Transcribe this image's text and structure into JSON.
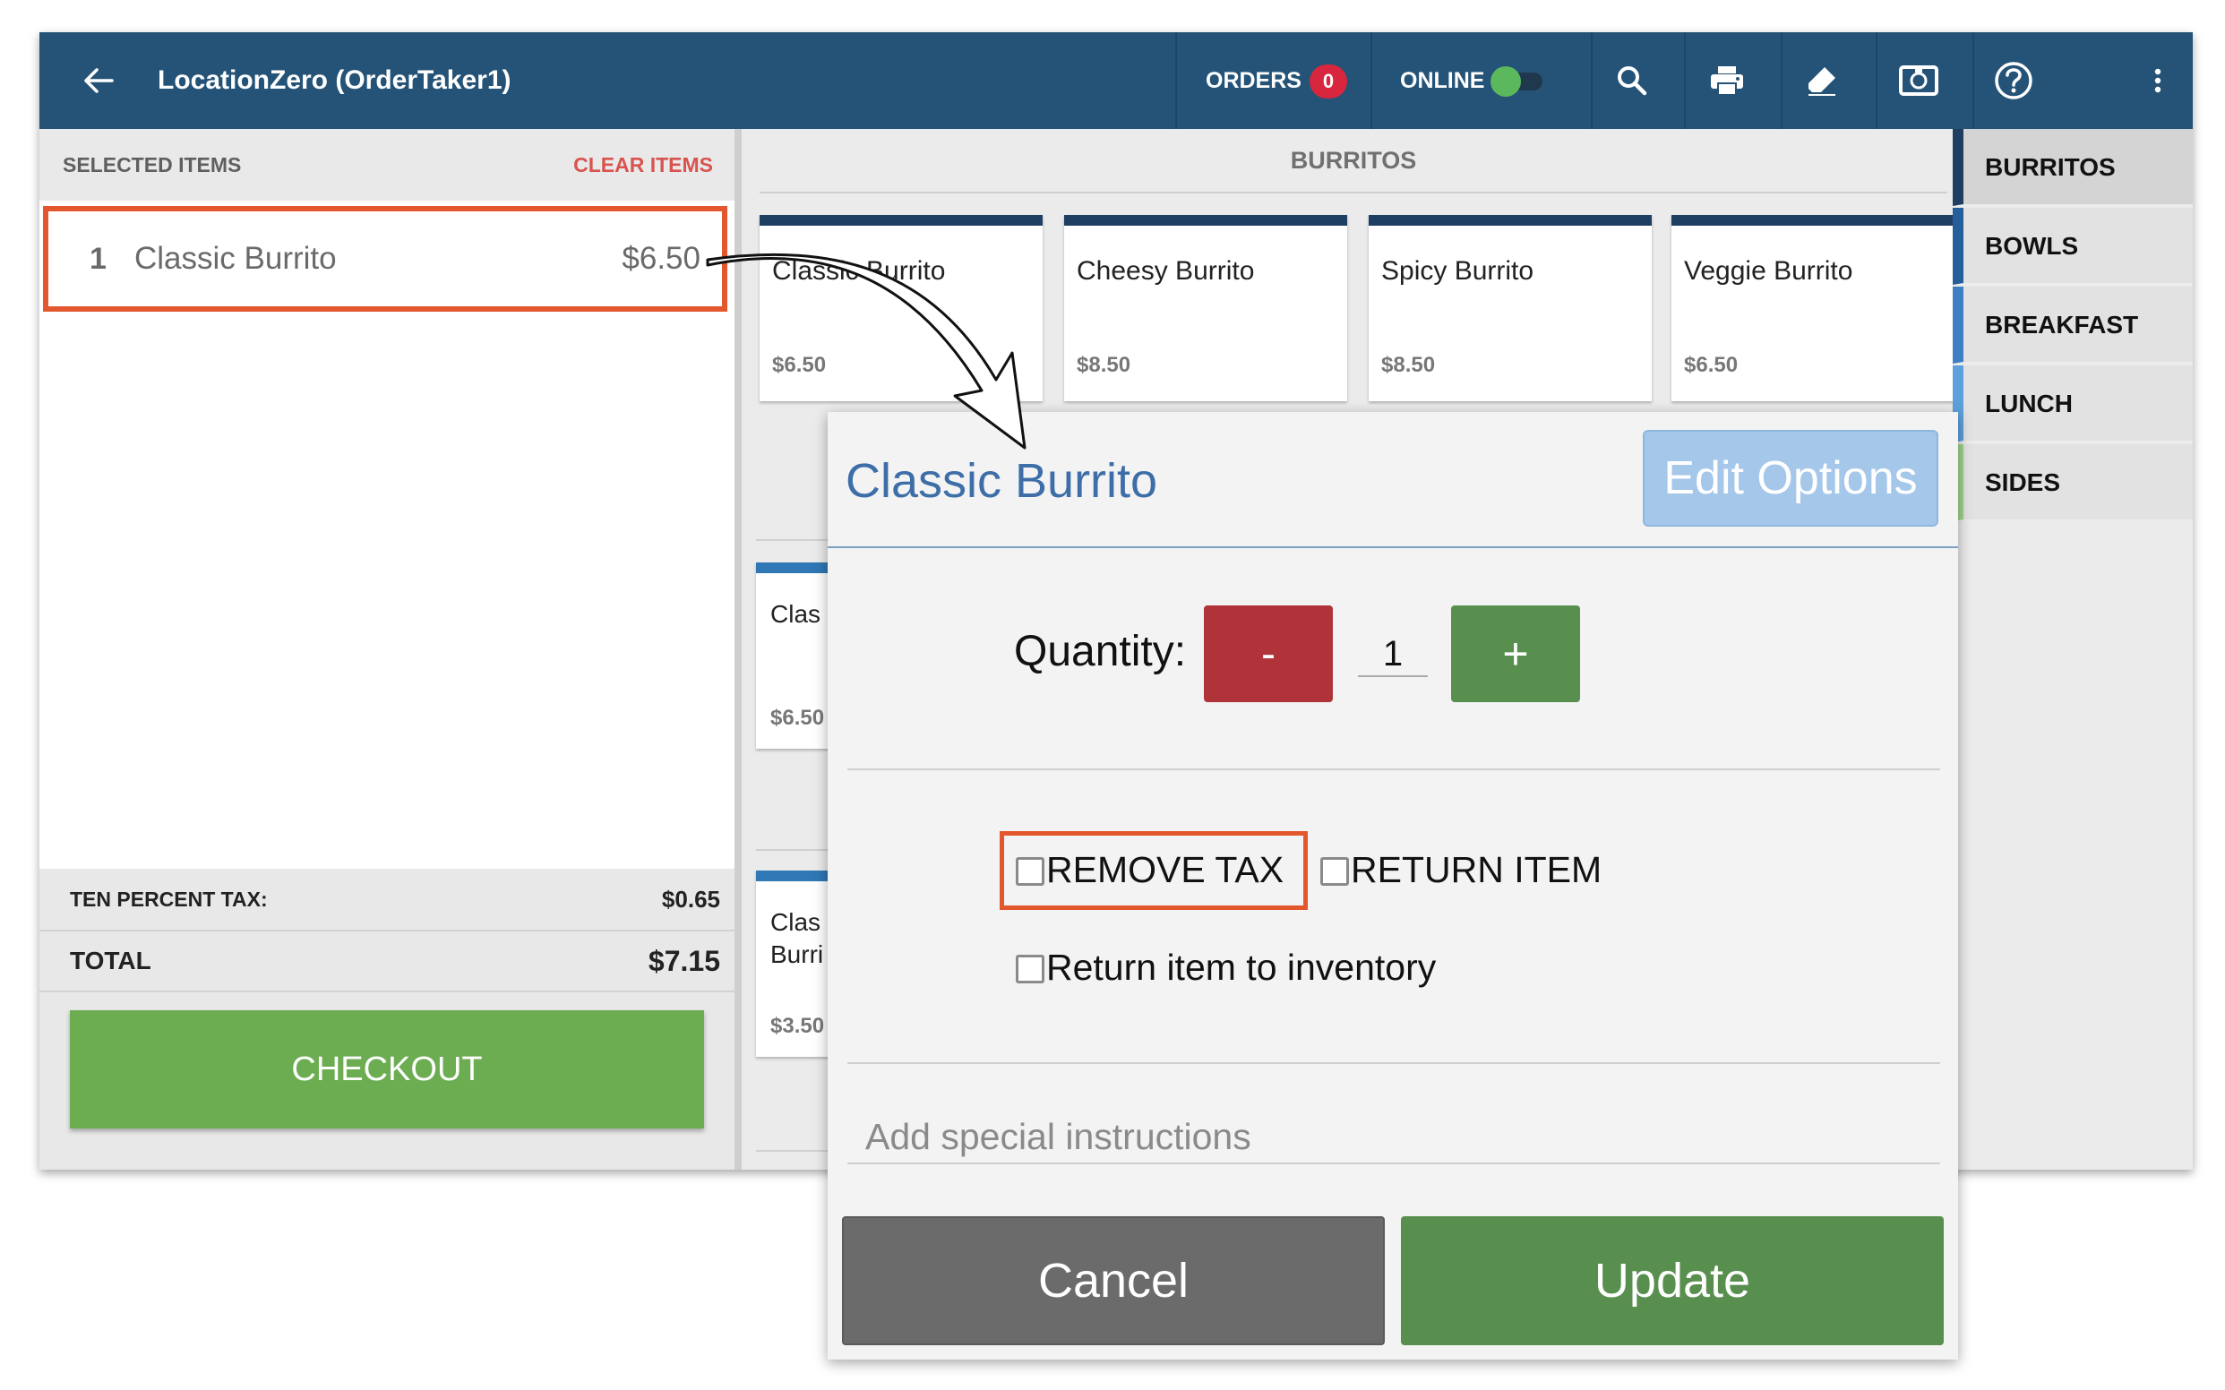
{
  "topbar": {
    "title": "LocationZero (OrderTaker1)",
    "orders_label": "ORDERS",
    "orders_count": "0",
    "online_label": "ONLINE",
    "online": true,
    "icons": [
      "back-arrow-icon",
      "search-icon",
      "printer-icon",
      "eraser-icon",
      "cash-drawer-icon",
      "help-icon",
      "more-vert-icon"
    ]
  },
  "order": {
    "header": "SELECTED ITEMS",
    "clear_label": "CLEAR ITEMS",
    "items": [
      {
        "qty": "1",
        "name": "Classic Burrito",
        "price": "$6.50"
      }
    ],
    "tax_label": "TEN PERCENT TAX:",
    "tax_value": "$0.65",
    "total_label": "TOTAL",
    "total_value": "$7.15",
    "checkout_label": "CHECKOUT"
  },
  "menu": {
    "category_title": "BURRITOS",
    "cards": [
      {
        "name": "Classic Burrito",
        "price": "$6.50"
      },
      {
        "name": "Cheesy Burrito",
        "price": "$8.50"
      },
      {
        "name": "Spicy Burrito",
        "price": "$8.50"
      },
      {
        "name": "Veggie Burrito",
        "price": "$6.50"
      }
    ],
    "partial_cards": [
      {
        "name": "Clas",
        "price": "$6.50"
      },
      {
        "name": "Clas\nBurri",
        "price": "$3.50"
      }
    ]
  },
  "categories": [
    {
      "label": "BURRITOS",
      "color": "#1f3f62"
    },
    {
      "label": "BOWLS",
      "color": "#245f9c"
    },
    {
      "label": "BREAKFAST",
      "color": "#3d7fc2"
    },
    {
      "label": "LUNCH",
      "color": "#5ea0db"
    },
    {
      "label": "SIDES",
      "color": "#9ed38b"
    }
  ],
  "dialog": {
    "title": "Classic Burrito",
    "edit_options_label": "Edit Options",
    "quantity_label": "Quantity:",
    "minus_label": "-",
    "quantity_value": "1",
    "plus_label": "+",
    "remove_tax_label": "REMOVE TAX",
    "return_item_label": "RETURN ITEM",
    "return_inventory_label": "Return item to inventory",
    "instructions_placeholder": "Add special instructions",
    "cancel_label": "Cancel",
    "update_label": "Update"
  },
  "colors": {
    "topbar": "#245377",
    "highlight": "#e2572d",
    "checkout": "#6cad51",
    "danger": "#b1333a",
    "success": "#588f4e"
  }
}
